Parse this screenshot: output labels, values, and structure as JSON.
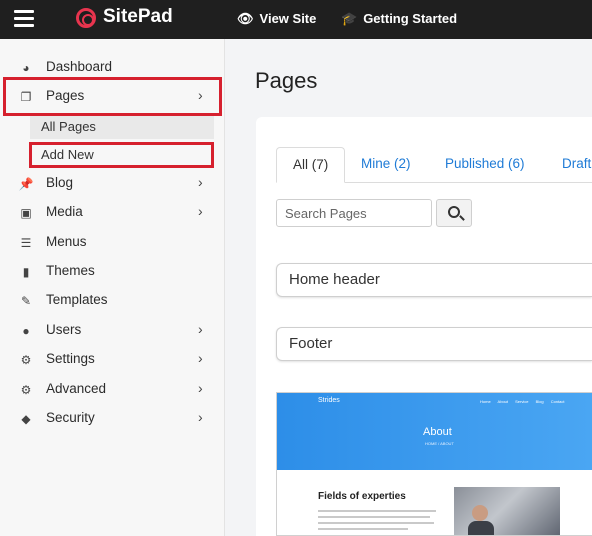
{
  "app": {
    "name": "SitePad",
    "brand_color": "#e8344e"
  },
  "topbar": {
    "menu_icon": "hamburger-icon",
    "links": [
      {
        "label": "View Site",
        "icon": "eye-icon"
      },
      {
        "label": "Getting Started",
        "icon": "graduation-cap-icon"
      }
    ]
  },
  "sidebar": {
    "items": [
      {
        "label": "Dashboard",
        "icon": "dashboard-icon",
        "has_submenu": false
      },
      {
        "label": "Pages",
        "icon": "pages-icon",
        "has_submenu": true
      },
      {
        "label": "Blog",
        "icon": "pin-icon",
        "has_submenu": true
      },
      {
        "label": "Media",
        "icon": "media-icon",
        "has_submenu": true
      },
      {
        "label": "Menus",
        "icon": "list-icon",
        "has_submenu": false
      },
      {
        "label": "Themes",
        "icon": "brush-icon",
        "has_submenu": false
      },
      {
        "label": "Templates",
        "icon": "paintbrush-icon",
        "has_submenu": false
      },
      {
        "label": "Users",
        "icon": "user-icon",
        "has_submenu": true
      },
      {
        "label": "Settings",
        "icon": "gears-icon",
        "has_submenu": true
      },
      {
        "label": "Advanced",
        "icon": "gear-icon",
        "has_submenu": true
      },
      {
        "label": "Security",
        "icon": "shield-icon",
        "has_submenu": true
      }
    ],
    "pages_submenu": [
      {
        "label": "All Pages",
        "active": true
      },
      {
        "label": "Add New",
        "active": false
      }
    ],
    "highlight_color": "#d6202e"
  },
  "main": {
    "title": "Pages",
    "tabs": [
      {
        "label": "All (7)",
        "active": true
      },
      {
        "label": "Mine (2)",
        "active": false
      },
      {
        "label": "Published (6)",
        "active": false
      },
      {
        "label": "Draft",
        "active": false
      }
    ],
    "search": {
      "placeholder": "Search Pages",
      "button_icon": "search-icon"
    },
    "rows": [
      {
        "label": "Home header"
      },
      {
        "label": "Footer"
      }
    ],
    "preview": {
      "brand": "Strides",
      "nav": "Home About Service Blog Contact",
      "hero_title": "About",
      "breadcrumb": "HOME / ABOUT",
      "heading": "Fields of experties"
    }
  }
}
